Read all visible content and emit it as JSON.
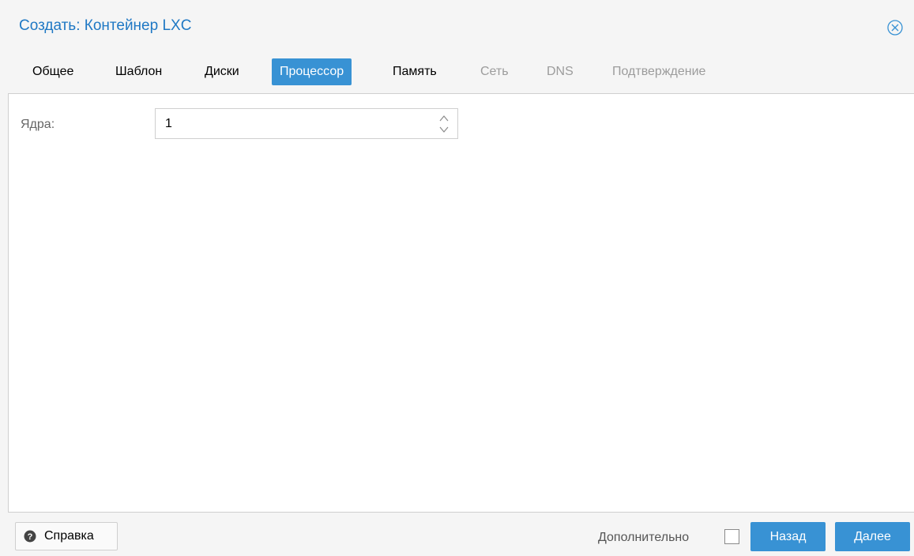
{
  "window": {
    "title": "Создать: Контейнер LXC"
  },
  "tabs": [
    {
      "label": "Общее",
      "state": "normal"
    },
    {
      "label": "Шаблон",
      "state": "normal"
    },
    {
      "label": "Диски",
      "state": "normal"
    },
    {
      "label": "Процессор",
      "state": "active"
    },
    {
      "label": "Память",
      "state": "normal"
    },
    {
      "label": "Сеть",
      "state": "disabled"
    },
    {
      "label": "DNS",
      "state": "disabled"
    },
    {
      "label": "Подтверждение",
      "state": "disabled"
    }
  ],
  "form": {
    "cores_label": "Ядра:",
    "cores_value": "1"
  },
  "footer": {
    "help_label": "Справка",
    "advanced_label": "Дополнительно",
    "advanced_checked": false,
    "back_label": "Назад",
    "next_label": "Далее"
  },
  "icons": {
    "close": "close-circle-icon",
    "help": "question-circle-icon",
    "spinner": "up-down-arrows-icon"
  },
  "colors": {
    "accent": "#3892d4",
    "title": "#1f78c4",
    "disabled": "#9c9c9c"
  }
}
